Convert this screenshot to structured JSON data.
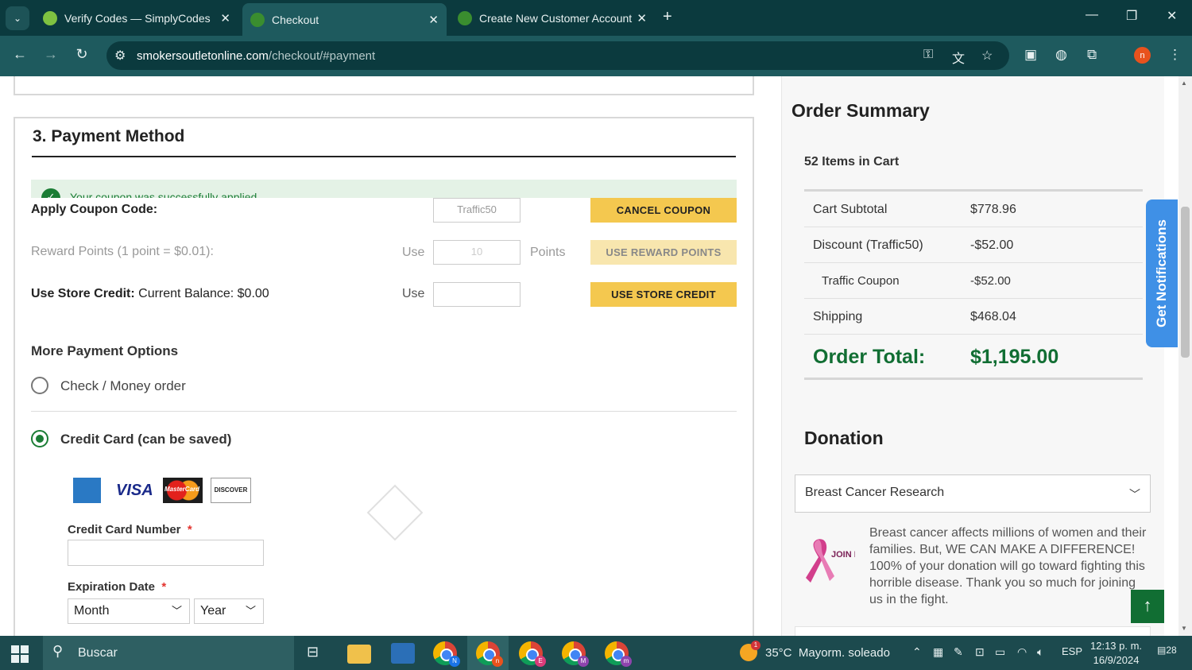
{
  "browser": {
    "tabs": [
      {
        "title": "Verify Codes — SimplyCodes",
        "active": false
      },
      {
        "title": "Checkout",
        "active": true
      },
      {
        "title": "Create New Customer Account",
        "active": false
      }
    ],
    "url_host": "smokersoutletonline.com",
    "url_path": "/checkout/#payment"
  },
  "payment": {
    "title": "3. Payment Method",
    "coupon_message": "Your coupon was successfully applied",
    "coupon_label": "Apply Coupon Code:",
    "coupon_value": "Traffic50",
    "cancel_coupon": "CANCEL COUPON",
    "reward_label": "Reward Points (1 point = $0.01):",
    "reward_use": "Use",
    "reward_placeholder": "10",
    "reward_points": "Points",
    "reward_button": "USE REWARD POINTS",
    "credit_label_bold": "Use Store Credit:",
    "credit_balance": " Current Balance: $0.00",
    "credit_use": "Use",
    "credit_button": "USE STORE CREDIT",
    "more_options": "More Payment Options",
    "option_check": "Check / Money order",
    "option_card": "Credit Card (can be saved)",
    "cc_number_label": "Credit Card Number",
    "required_mark": "*",
    "exp_label": "Expiration Date",
    "month": "Month",
    "year": "Year",
    "card_visa": "VISA",
    "card_mc": "MasterCard",
    "card_discover": "DISCOVER"
  },
  "summary": {
    "title": "Order Summary",
    "items": "52 Items in Cart",
    "rows": [
      {
        "label": "Cart Subtotal",
        "value": "$778.96"
      },
      {
        "label": "Discount (Traffic50)",
        "value": "-$52.00"
      },
      {
        "label": "Traffic Coupon",
        "value": "-$52.00"
      },
      {
        "label": "Shipping",
        "value": "$468.04"
      }
    ],
    "total_label": "Order Total:",
    "total_value": "$1,195.00"
  },
  "donation": {
    "title": "Donation",
    "selected": "Breast Cancer Research",
    "logo_text": "JOIN FIGHT",
    "text": "Breast cancer affects millions of women and their families. But, WE CAN MAKE A DIFFERENCE! 100% of your donation will go toward fighting this horrible disease. Thank you so much for joining us in the fight."
  },
  "notifications_tab": "Get Notifications",
  "taskbar": {
    "search": "Buscar",
    "weather_temp": "35°C",
    "weather_desc": "Mayorm. soleado",
    "weather_badge": "1",
    "lang": "ESP",
    "time": "12:13 p. m.",
    "date": "16/9/2024",
    "notif_count": "28",
    "chrome_badges": [
      "N",
      "n",
      "E",
      "M",
      "m"
    ]
  },
  "colors": {
    "accent_green": "#116e33",
    "button_yellow": "#f4c84f",
    "browser_dark": "#0b3a3e",
    "notif_blue": "#3f90e6"
  }
}
